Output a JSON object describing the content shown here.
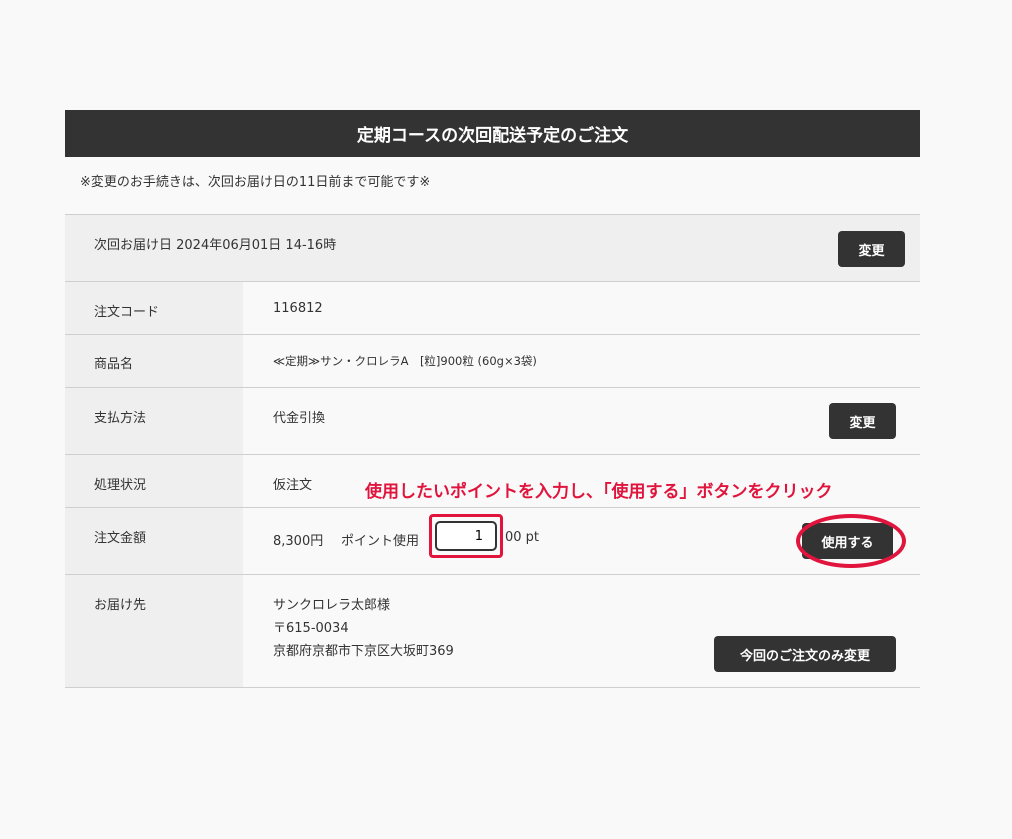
{
  "panel": {
    "title": "定期コースの次回配送予定のご注文",
    "notice": "※変更のお手続きは、次回お届け日の11日前まで可能です※"
  },
  "delivery": {
    "text": "次回お届け日 2024年06月01日 14-16時",
    "change_label": "変更"
  },
  "rows": {
    "order_code": {
      "label": "注文コード",
      "value": "116812"
    },
    "product": {
      "label": "商品名",
      "value": "≪定期≫サン・クロレラA　[粒]900粒 (60g×3袋)"
    },
    "payment": {
      "label": "支払方法",
      "value": "代金引換",
      "change_label": "変更"
    },
    "status": {
      "label": "処理状況",
      "value": "仮注文"
    },
    "amount": {
      "label": "注文金額",
      "price": "8,300円",
      "point_label": "ポイント使用",
      "point_value": "1",
      "point_suffix": "00 pt",
      "use_label": "使用する"
    },
    "address": {
      "label": "お届け先",
      "name": "サンクロレラ太郎様",
      "postal": "〒615-0034",
      "addr": "京都府京都市下京区大坂町369",
      "change_label": "今回のご注文のみ変更"
    }
  },
  "annotation": {
    "text": "使用したいポイントを入力し、「使用する」ボタンをクリック",
    "color": "#e0143c"
  }
}
